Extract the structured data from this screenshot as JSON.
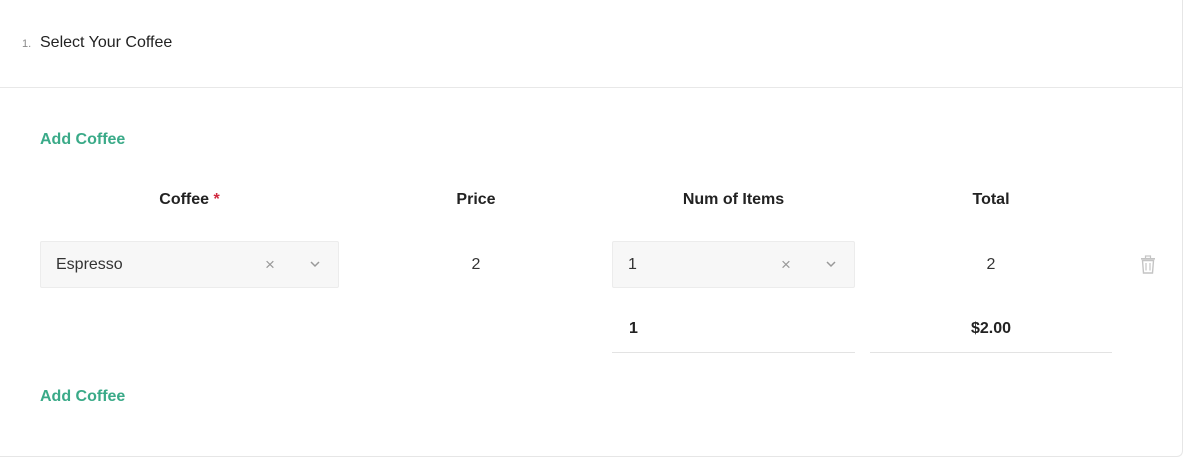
{
  "step": {
    "number": "1.",
    "title": "Select Your Coffee"
  },
  "actions": {
    "add_coffee_top": "Add Coffee",
    "add_coffee_bottom": "Add Coffee"
  },
  "table": {
    "headers": {
      "coffee": "Coffee",
      "required_mark": "*",
      "price": "Price",
      "num_items": "Num of Items",
      "total": "Total"
    },
    "rows": [
      {
        "coffee": "Espresso",
        "price": "2",
        "num_items": "1",
        "total": "2"
      }
    ],
    "summary": {
      "num_items": "1",
      "total": "$2.00"
    }
  },
  "icons": {
    "clear": "×",
    "dropdown": "chevron-down-icon",
    "delete": "trash-icon"
  },
  "colors": {
    "accent": "#3aaa88",
    "required": "#d0293f"
  }
}
